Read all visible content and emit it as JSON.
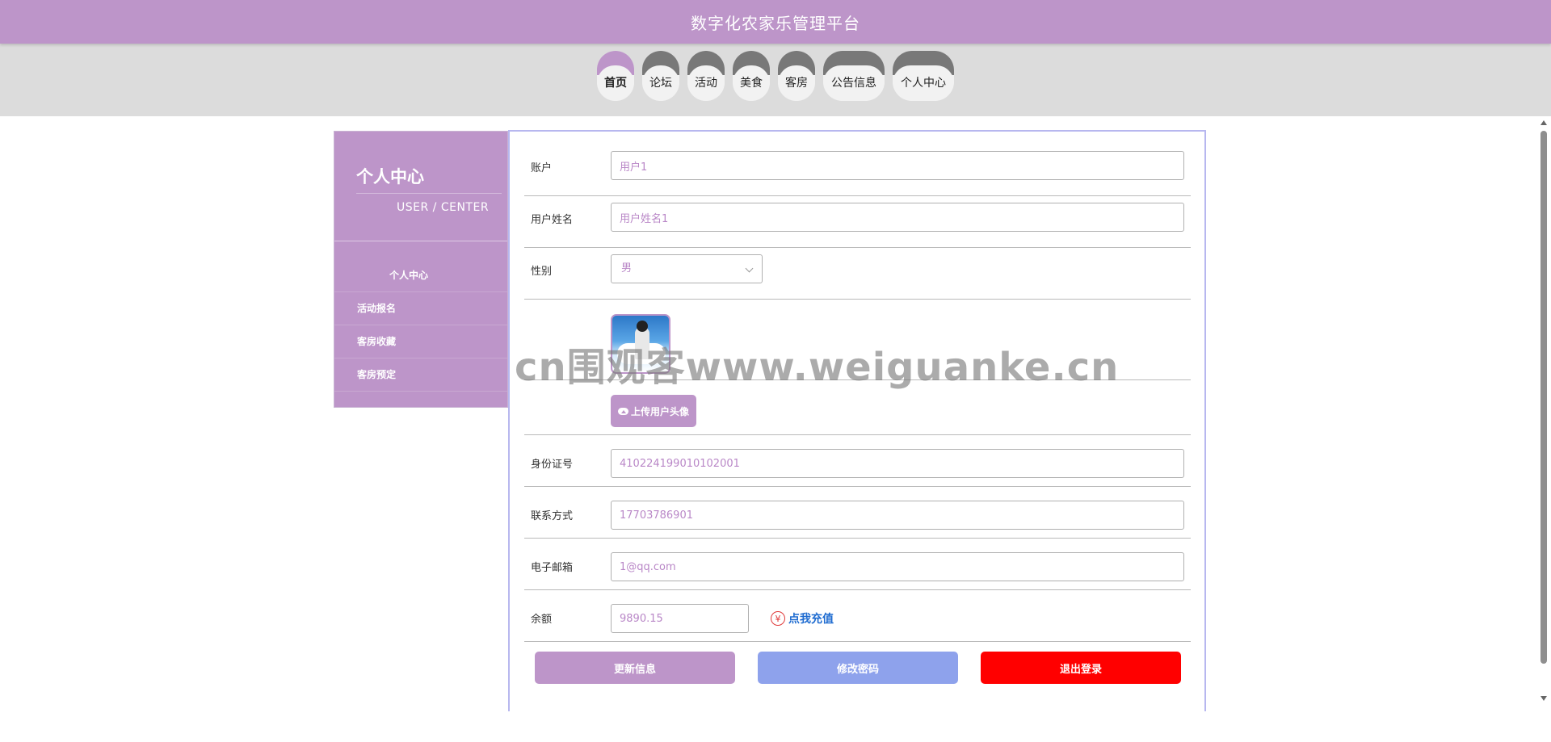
{
  "header": {
    "title": "数字化农家乐管理平台",
    "color": "#bd95c9"
  },
  "nav": {
    "items": [
      {
        "label": "首页",
        "active": true
      },
      {
        "label": "论坛"
      },
      {
        "label": "活动"
      },
      {
        "label": "美食"
      },
      {
        "label": "客房"
      },
      {
        "label": "公告信息"
      },
      {
        "label": "个人中心"
      }
    ]
  },
  "sidebar": {
    "title": "个人中心",
    "subtitle": "USER / CENTER",
    "menu": [
      "个人中心",
      "活动报名",
      "客房收藏",
      "客房预定"
    ]
  },
  "form": {
    "account": {
      "label": "账户",
      "value": "用户1"
    },
    "name": {
      "label": "用户姓名",
      "value": "用户姓名1"
    },
    "gender": {
      "label": "性别",
      "value": "男"
    },
    "upload_label": "上传用户头像",
    "idcard": {
      "label": "身份证号",
      "value": "410224199010102001"
    },
    "phone": {
      "label": "联系方式",
      "value": "17703786901"
    },
    "email": {
      "label": "电子邮箱",
      "value": "1@qq.com"
    },
    "balance": {
      "label": "余额",
      "value": "9890.15",
      "recharge_symbol": "¥",
      "recharge_label": "点我充值"
    }
  },
  "buttons": {
    "update": "更新信息",
    "password": "修改密码",
    "logout": "退出登录"
  },
  "watermark": "cn围观客www.weiguanke.cn",
  "colors": {
    "accent": "#bd95c9",
    "password_btn": "#8ea2ec",
    "logout_btn": "#ff0000",
    "link": "#1e6bd0"
  }
}
